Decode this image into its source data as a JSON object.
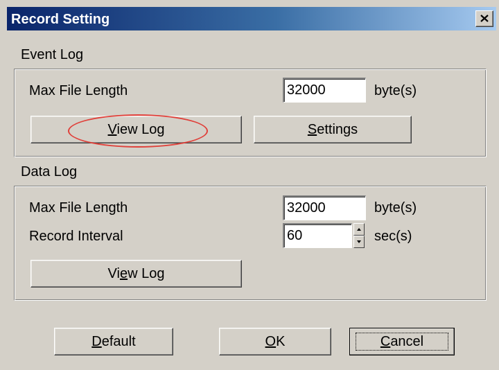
{
  "window": {
    "title": "Record Setting",
    "close_icon": "close-icon"
  },
  "event_log": {
    "section_title": "Event Log",
    "max_file_length_label": "Max File Length",
    "max_file_length_value": "32000",
    "max_file_length_unit": "byte(s)",
    "view_log_button": {
      "pre": "",
      "key": "V",
      "post": "iew Log"
    },
    "settings_button": {
      "pre": "",
      "key": "S",
      "post": "ettings"
    }
  },
  "data_log": {
    "section_title": "Data Log",
    "max_file_length_label": "Max File Length",
    "max_file_length_value": "32000",
    "max_file_length_unit": "byte(s)",
    "record_interval_label": "Record Interval",
    "record_interval_value": "60",
    "record_interval_unit": "sec(s)",
    "view_log_button": {
      "pre": "Vi",
      "key": "e",
      "post": "w Log"
    }
  },
  "footer": {
    "default_button": {
      "pre": "",
      "key": "D",
      "post": "efault"
    },
    "ok_button": {
      "pre": "",
      "key": "O",
      "post": "K"
    },
    "cancel_button": {
      "pre": "",
      "key": "C",
      "post": "ancel"
    }
  },
  "colors": {
    "title_bar_start": "#0a246a",
    "title_bar_end": "#a6caf0",
    "dialog_background": "#d4d0c8",
    "annotation_circle": "#e0403a"
  }
}
